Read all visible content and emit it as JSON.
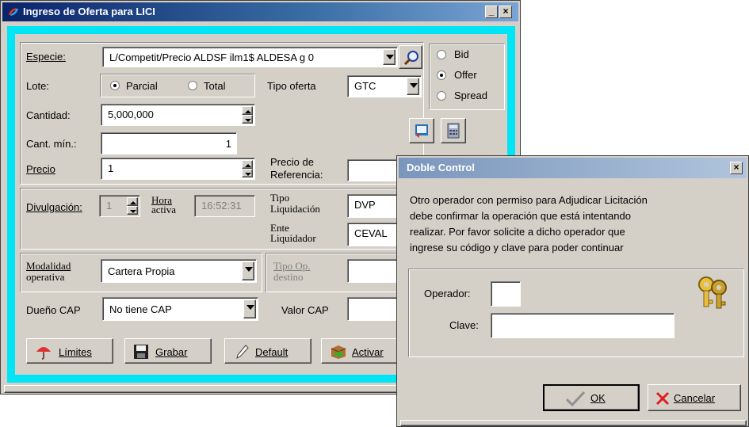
{
  "main_window": {
    "title": "Ingreso de Oferta para LICI",
    "minimize_glyph": "_",
    "close_glyph": "×",
    "especie_label": "Especie:",
    "especie_value": "L/Competit/Precio ALDSF ilm1$ ALDESA g 0",
    "side_options": [
      "Bid",
      "Offer",
      "Spread"
    ],
    "side_selected": "Offer",
    "lote_label": "Lote:",
    "lote_options": [
      "Parcial",
      "Total"
    ],
    "lote_selected": "Parcial",
    "tipo_oferta_label": "Tipo oferta",
    "tipo_oferta_value": "GTC",
    "cantidad_label": "Cantidad:",
    "cantidad_value": "5,000,000",
    "cant_min_label": "Cant. mín.:",
    "cant_min_value": "1",
    "precio_label": "Precio",
    "precio_value": "1",
    "precio_ref_label_1": "Precio de",
    "precio_ref_label_2": "Referencia:",
    "divulgacion_label": "Divulgación:",
    "divulgacion_value": "1",
    "hora_label_1": "Hora",
    "hora_label_2": "activa",
    "hora_value": "16:52:31",
    "tipo_liq_label_1": "Tipo",
    "tipo_liq_label_2": "Liquidación",
    "tipo_liq_value": "DVP",
    "ente_label_1": "Ente",
    "ente_label_2": "Liquidador",
    "ente_value": "CEVAL",
    "modalidad_label_1": "Modalidad",
    "modalidad_label_2": "operativa",
    "modalidad_value": "Cartera Propia",
    "tipo_op_label_1": "Tipo Op.",
    "tipo_op_label_2": "destino",
    "dueno_label": "Dueño CAP",
    "dueno_value": "No tiene CAP",
    "valor_cap_label": "Valor CAP",
    "buttons": {
      "limites": "Límites",
      "grabar": "Grabar",
      "default": "Default",
      "activar": "Activar"
    }
  },
  "dialog": {
    "title": "Doble Control",
    "close_glyph": "×",
    "message_lines": [
      "Otro operador con permiso para Adjudicar Licitación",
      "debe confirmar la operación que está intentando",
      "realizar. Por favor solicite a dicho operador que",
      "ingrese su código y clave para poder continuar"
    ],
    "operador_label": "Operador:",
    "operador_value": "",
    "clave_label": "Clave:",
    "clave_value": "",
    "ok_label": "OK",
    "cancel_label": "Cancelar"
  },
  "colors": {
    "title_gradient_start": "#0a246a",
    "title_gradient_end": "#7aa4d4",
    "cyan_frame": "#00e5f5",
    "face": "#d4d0c8"
  },
  "icons": [
    "app-icon",
    "search-icon",
    "help-book-icon",
    "calculator-icon",
    "umbrella-icon",
    "floppy-disk-icon",
    "pencil-icon",
    "activate-box-icon",
    "keys-icon",
    "checkmark-icon",
    "x-icon"
  ]
}
